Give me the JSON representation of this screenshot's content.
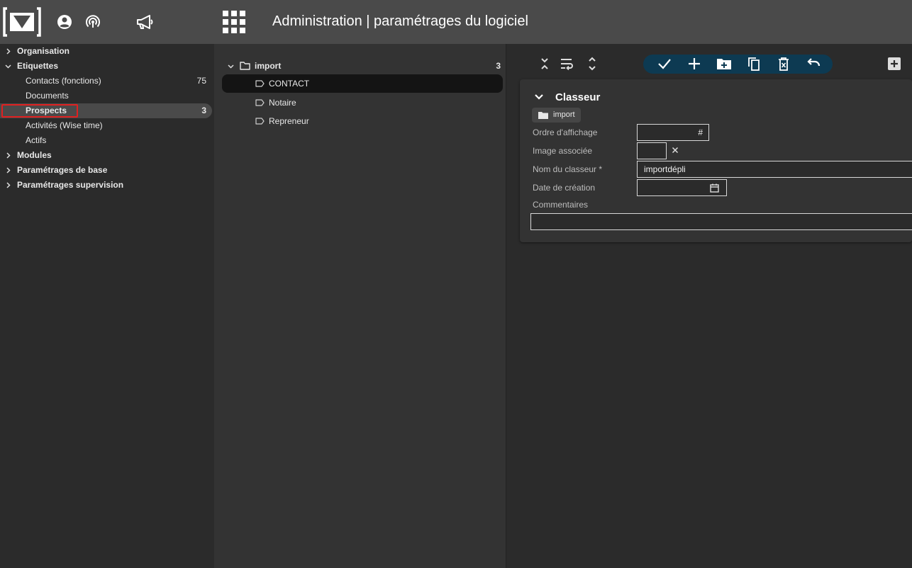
{
  "header": {
    "title": "Administration | paramétrages du logiciel",
    "icons": [
      "logo",
      "account-icon",
      "podcast-icon",
      "megaphone-icon",
      "apps-grid-icon"
    ]
  },
  "sidebar": {
    "items": [
      {
        "label": "Organisation",
        "type": "group",
        "expanded": false
      },
      {
        "label": "Etiquettes",
        "type": "group",
        "expanded": true
      },
      {
        "label": "Contacts (fonctions)",
        "type": "child",
        "count": "75"
      },
      {
        "label": "Documents",
        "type": "child"
      },
      {
        "label": "Prospects",
        "type": "child",
        "count": "3",
        "selected": true
      },
      {
        "label": "Activités (Wise time)",
        "type": "child"
      },
      {
        "label": "Actifs",
        "type": "child"
      },
      {
        "label": "Modules",
        "type": "group",
        "expanded": false
      },
      {
        "label": "Paramétrages de base",
        "type": "group",
        "expanded": false
      },
      {
        "label": "Paramétrages supervision",
        "type": "group",
        "expanded": false
      }
    ]
  },
  "tree": {
    "root": {
      "label": "import",
      "count": "3"
    },
    "items": [
      {
        "label": "CONTACT",
        "selected": true
      },
      {
        "label": "Notaire"
      },
      {
        "label": "Repreneur"
      }
    ]
  },
  "toolbar": {
    "icons": [
      "collapse-all-icon",
      "wrap-icon",
      "expand-all-icon"
    ],
    "actions": [
      "check-icon",
      "plus-icon",
      "new-folder-icon",
      "copy-icon",
      "delete-icon",
      "undo-icon"
    ],
    "extra": "add-box-icon",
    "accent": "#0d3a52"
  },
  "form": {
    "title": "Classeur",
    "chip": "import",
    "fields": {
      "order": {
        "label": "Ordre d'affichage",
        "value": "",
        "suffix": "#"
      },
      "image": {
        "label": "Image associée",
        "value": ""
      },
      "name": {
        "label": "Nom du classeur *",
        "value": "importdépli"
      },
      "date": {
        "label": "Date de création",
        "value": ""
      },
      "comments": {
        "label": "Commentaires",
        "value": ""
      }
    }
  }
}
